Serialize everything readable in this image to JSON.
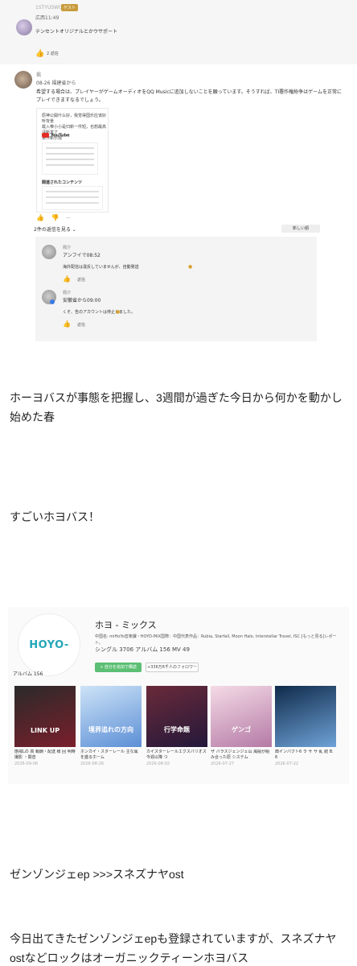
{
  "comment1": {
    "username": "1STYUSWG",
    "badge": "ゲスト",
    "date": "広西11:49",
    "text": "テンセントオリジナルとかウサポート",
    "replies_label": "2 返信"
  },
  "comment2": {
    "username": "楓",
    "date": "08-26 福建省から",
    "text": "希望する場合は、プレイヤーがゲームオーディオをQQ Musicに追加しないことを願っています。そうすれば、TI署作権紛争はゲームを正常にプレイできますなるでしょう。",
    "embed_lines": [
      "原神公開什么好，我觉得国乐应该好听背景",
      "载入带小小是归新一件短，也想最高评新发了",
      "某作新乐观"
    ],
    "embed_source": "YouTube",
    "embed_related": "関連されたコンテンツ",
    "replies_toggle": "2件の返信を見る",
    "sort_label": "新しい順"
  },
  "replies": [
    {
      "name": "楓汐",
      "location": "アンフイで08:52",
      "text": "海外配信は違反していませんが、自動発送",
      "reply_label": "返信"
    },
    {
      "name": "楓汐",
      "location": "安徽省から09:00",
      "text": "くそ、告のアカウントは停止しました。",
      "reply_label": "返信"
    }
  ],
  "post": {
    "p1": "ホーヨバスが事態を把握し、3週間が過ぎた今日から何かを動かし始めた春",
    "p2": "すごいホヨバス！",
    "p3": "ゼンゾンジェep >>>スネズナヤost",
    "p4": "今日出てきたゼンゾンジェepも登録されていますが、スネズナヤostなどロックはオーガニックティーンホヨバス"
  },
  "hoyomix": {
    "logo_text": "HOYO-MiX",
    "name": "ホヨ - ミックス",
    "description": "中国名: miHoYo音楽課・HOYO-MiX国際：中国代表作品：Rubia, Starfall, Moon Halo, Interstellar Travel, ISC [もっと見る]レポート。",
    "stats": "シングル 3706 アルバム 156 MV 49",
    "follow_label": "+ 自分を追加で購読",
    "fans_label": "+336万6千人のフォロワー",
    "albums_label": "アルバム 156",
    "albums": [
      {
        "cover_text": "LINK UP",
        "title": "懲戒Lの 高 報酬・配送 様 回 明時 撮影 ・関音",
        "date": "2026-09-06",
        "colors": [
          "#2a2a2a",
          "#7a1f2b"
        ]
      },
      {
        "cover_text": "境界追れの方向",
        "title": "ホンカイ・スターレール 主な属を盛るホーム",
        "date": "2026-08-26",
        "colors": [
          "#cde3f7",
          "#5c8fd6"
        ]
      },
      {
        "cover_text": "行学命题",
        "title": "カイスターレールエクスパリオス 今週以降 つ",
        "date": "2026-08-02",
        "colors": [
          "#6a2a3a",
          "#24183a"
        ]
      },
      {
        "cover_text": "ゲンゴ",
        "title": "ザ バラスジェンジェ山 風船が組み合った原 システム",
        "date": "2026-07-27",
        "colors": [
          "#f4dbe6",
          "#b57aa6"
        ]
      },
      {
        "cover_text": "",
        "title": "典インパクト6 ラ サ サ 乱 結 B. 6",
        "date": "2026-07-22",
        "colors": [
          "#0f2a4a",
          "#6fa3d8"
        ]
      }
    ]
  },
  "colors": {
    "accent_green": "#5cbf74",
    "logo_teal": "#22a7b8",
    "link_blue": "#3b7ce6"
  }
}
